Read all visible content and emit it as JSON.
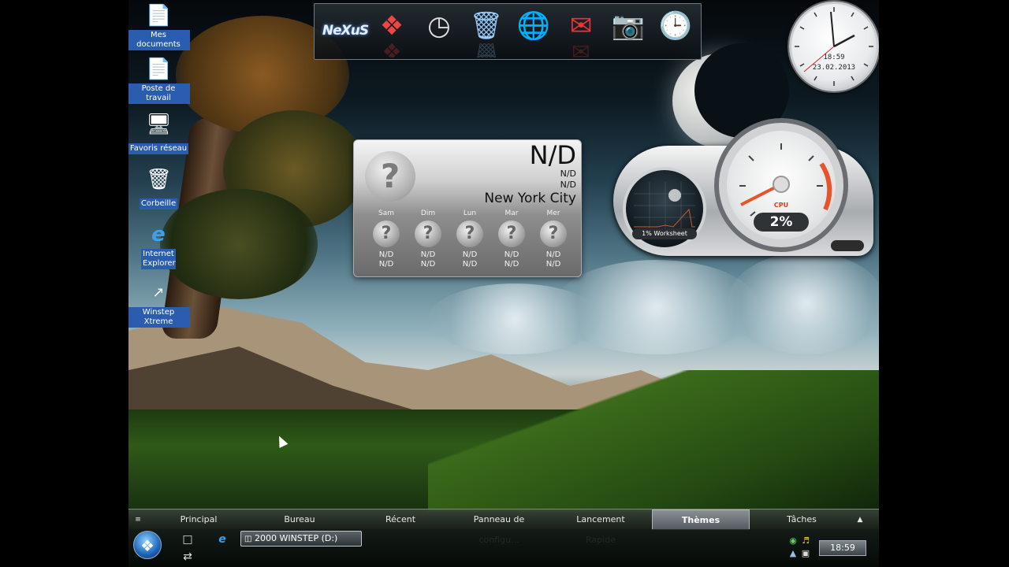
{
  "desktop": {
    "icons": [
      {
        "label": "Mes documents",
        "icon": "document-icon"
      },
      {
        "label": "Poste de travail",
        "icon": "computer-icon"
      },
      {
        "label": "Favoris réseau",
        "icon": "network-icon"
      },
      {
        "label": "Corbeille",
        "icon": "recycle-bin-icon"
      },
      {
        "label": "Internet Explorer",
        "icon": "internet-explorer-icon"
      },
      {
        "label": "Winstep Xtreme",
        "icon": "winstep-icon"
      }
    ]
  },
  "dock": {
    "logo_text": "NeXuS",
    "items": [
      "nexus-logo",
      "windows-logo-icon",
      "clock-icon",
      "recycle-bin-icon",
      "globe-icon",
      "mail-icon",
      "camera-icon",
      "monitor-clock-icon"
    ]
  },
  "clock": {
    "time": "18:59",
    "date": "23.02.2013"
  },
  "weather": {
    "temperature": "N/D",
    "line1": "N/D",
    "line2": "N/D",
    "city": "New York City",
    "days": [
      {
        "name": "Sam",
        "high": "N/D",
        "low": "N/D"
      },
      {
        "name": "Dim",
        "high": "N/D",
        "low": "N/D"
      },
      {
        "name": "Lun",
        "high": "N/D",
        "low": "N/D"
      },
      {
        "name": "Mar",
        "high": "N/D",
        "low": "N/D"
      },
      {
        "name": "Mer",
        "high": "N/D",
        "low": "N/D"
      }
    ]
  },
  "cpu_meter": {
    "label": "CPU",
    "percent": "2%",
    "worksheet": "1% Worksheet"
  },
  "menubar": {
    "items": [
      "Principal",
      "Bureau",
      "Récent",
      "Panneau de configu...",
      "Lancement Rapide",
      "Thèmes",
      "Tâches"
    ],
    "active": "Thèmes"
  },
  "taskbar": {
    "task_button": "2000 WINSTEP (D:)",
    "tray_clock": "18:59"
  },
  "colors": {
    "icon_label_bg": "#2a5db0",
    "cpu_accent": "#d83b1f"
  }
}
